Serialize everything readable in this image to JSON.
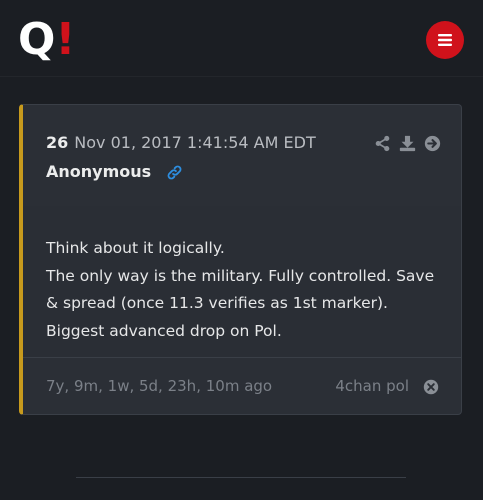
{
  "header": {
    "logo_letter": "Q",
    "logo_mark": "!",
    "menu_icon": "hamburger-icon",
    "brand_color": "#d0121b"
  },
  "post": {
    "number": "26",
    "date": "Nov 01, 2017 1:41:54 AM EDT",
    "author": "Anonymous",
    "author_icon": "link-icon",
    "actions": [
      "share-icon",
      "download-icon",
      "arrow-right-circle-icon"
    ],
    "message_lines": [
      "Think about it logically.",
      "The only way is the military. Fully controlled. Save",
      "& spread (once 11.3 verifies as 1st marker).",
      "Biggest advanced drop on Pol."
    ],
    "ago": "7y, 9m, 1w, 5d, 23h, 10m ago",
    "source": "4chan pol",
    "accent_color": "#c79a1d"
  }
}
